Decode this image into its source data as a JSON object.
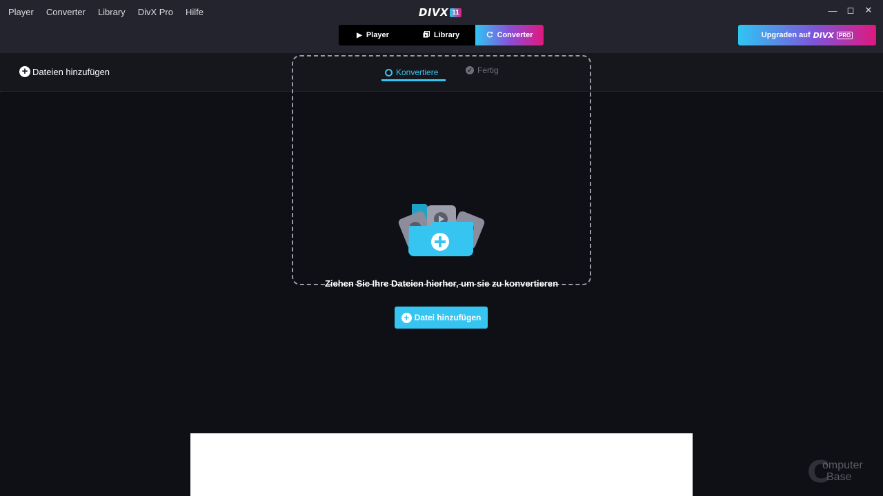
{
  "menu": {
    "items": [
      {
        "label": "Player"
      },
      {
        "label": "Converter"
      },
      {
        "label": "Library"
      },
      {
        "label": "DivX Pro"
      },
      {
        "label": "Hilfe"
      }
    ]
  },
  "logo": {
    "text": "DIVX",
    "badge": "11"
  },
  "window_controls": {
    "minimize": "—",
    "maximize": "◻",
    "close": "✕"
  },
  "mode_tabs": [
    {
      "label": "Player",
      "icon": "play-icon",
      "active": false
    },
    {
      "label": "Library",
      "icon": "library-icon",
      "active": false
    },
    {
      "label": "Converter",
      "icon": "refresh-icon",
      "active": true
    }
  ],
  "upgrade": {
    "label": "Upgraden auf",
    "brand": "DIVX",
    "pro": "PRO"
  },
  "toolbar": {
    "add_files_label": "Dateien hinzufügen"
  },
  "tabs": {
    "convert_label": "Konvertiere",
    "done_label": "Fertig",
    "active": "convert"
  },
  "dropzone": {
    "text": "Ziehen Sie Ihre Dateien hierher, um sie zu konvertieren",
    "add_button_label": "Datei hinzufügen"
  },
  "watermark": {
    "letter": "C",
    "line1": "omputer",
    "line2": "Base"
  },
  "colors": {
    "accent": "#36c4f1",
    "gradient_start": "#2ec6f3",
    "gradient_end": "#e0187d",
    "background": "#0f1015",
    "header": "#23242d"
  }
}
